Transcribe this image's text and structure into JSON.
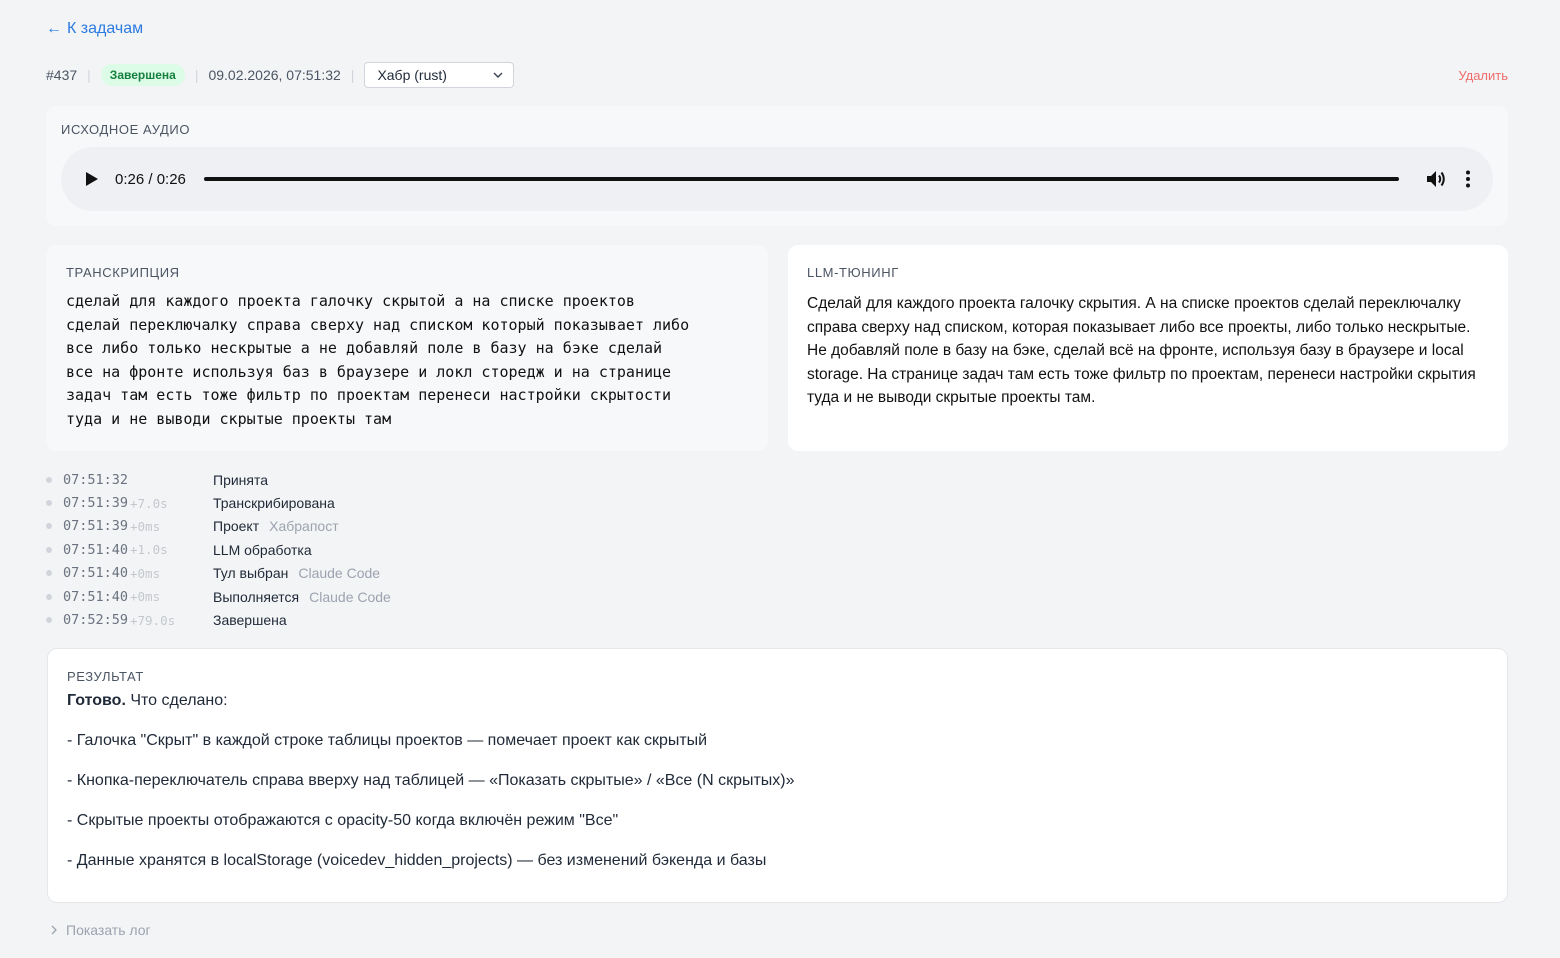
{
  "nav": {
    "back_label": "К задачам"
  },
  "task": {
    "id": "#437",
    "status": "Завершена",
    "datetime": "09.02.2026, 07:51:32",
    "project_selected": "Хабр (rust)",
    "delete_label": "Удалить"
  },
  "audio": {
    "label": "Исходное аудио",
    "time": "0:26 / 0:26"
  },
  "transcription": {
    "label": "Транскрипция",
    "lines": [
      "сделай для каждого проекта галочку скрытой а на списке проектов",
      "сделай переключалку справа сверху над списком который показывает либо",
      "все либо только нескрытые а не добавляй поле в базу на бэке сделай",
      "все на фронте используя баз в браузере и локл сторедж и на странице",
      "задач там есть тоже фильтр по проектам перенеси настройки скрытости",
      "туда и не выводи скрытые проекты там"
    ]
  },
  "llm": {
    "label": "LLM-тюнинг",
    "text": "Сделай для каждого проекта галочку скрытия. А на списке проектов сделай переключалку справа сверху над списком, которая показывает либо все проекты, либо только нескрытые. Не добавляй поле в базу на бэке, сделай всё на фронте, используя базу в браузере и local storage. На странице задач там есть тоже фильтр по проектам, перенеси настройки скрытия туда и не выводи скрытые проекты там."
  },
  "timeline": [
    {
      "time": "07:51:32",
      "delta": "",
      "label": "Принята",
      "extra": ""
    },
    {
      "time": "07:51:39",
      "delta": "+7.0s",
      "label": "Транскрибирована",
      "extra": ""
    },
    {
      "time": "07:51:39",
      "delta": "+0ms",
      "label": "Проект",
      "extra": "Хабрапост"
    },
    {
      "time": "07:51:40",
      "delta": "+1.0s",
      "label": "LLM обработка",
      "extra": ""
    },
    {
      "time": "07:51:40",
      "delta": "+0ms",
      "label": "Тул выбран",
      "extra": "Claude Code"
    },
    {
      "time": "07:51:40",
      "delta": "+0ms",
      "label": "Выполняется",
      "extra": "Claude Code"
    },
    {
      "time": "07:52:59",
      "delta": "+79.0s",
      "label": "Завершена",
      "extra": ""
    }
  ],
  "result": {
    "label": "Результат",
    "intro_bold": "Готово.",
    "intro_rest": " Что сделано:",
    "items": [
      "- Галочка \"Скрыт\" в каждой строке таблицы проектов — помечает проект как скрытый",
      "- Кнопка-переключатель справа вверху над таблицей — «Показать скрытые» / «Все (N скрытых)»",
      "- Скрытые проекты отображаются с opacity-50 когда включён режим \"Все\"",
      "- Данные хранятся в localStorage (voicedev_hidden_projects) — без изменений бэкенда и базы"
    ]
  },
  "log": {
    "toggle_label": "Показать лог"
  }
}
